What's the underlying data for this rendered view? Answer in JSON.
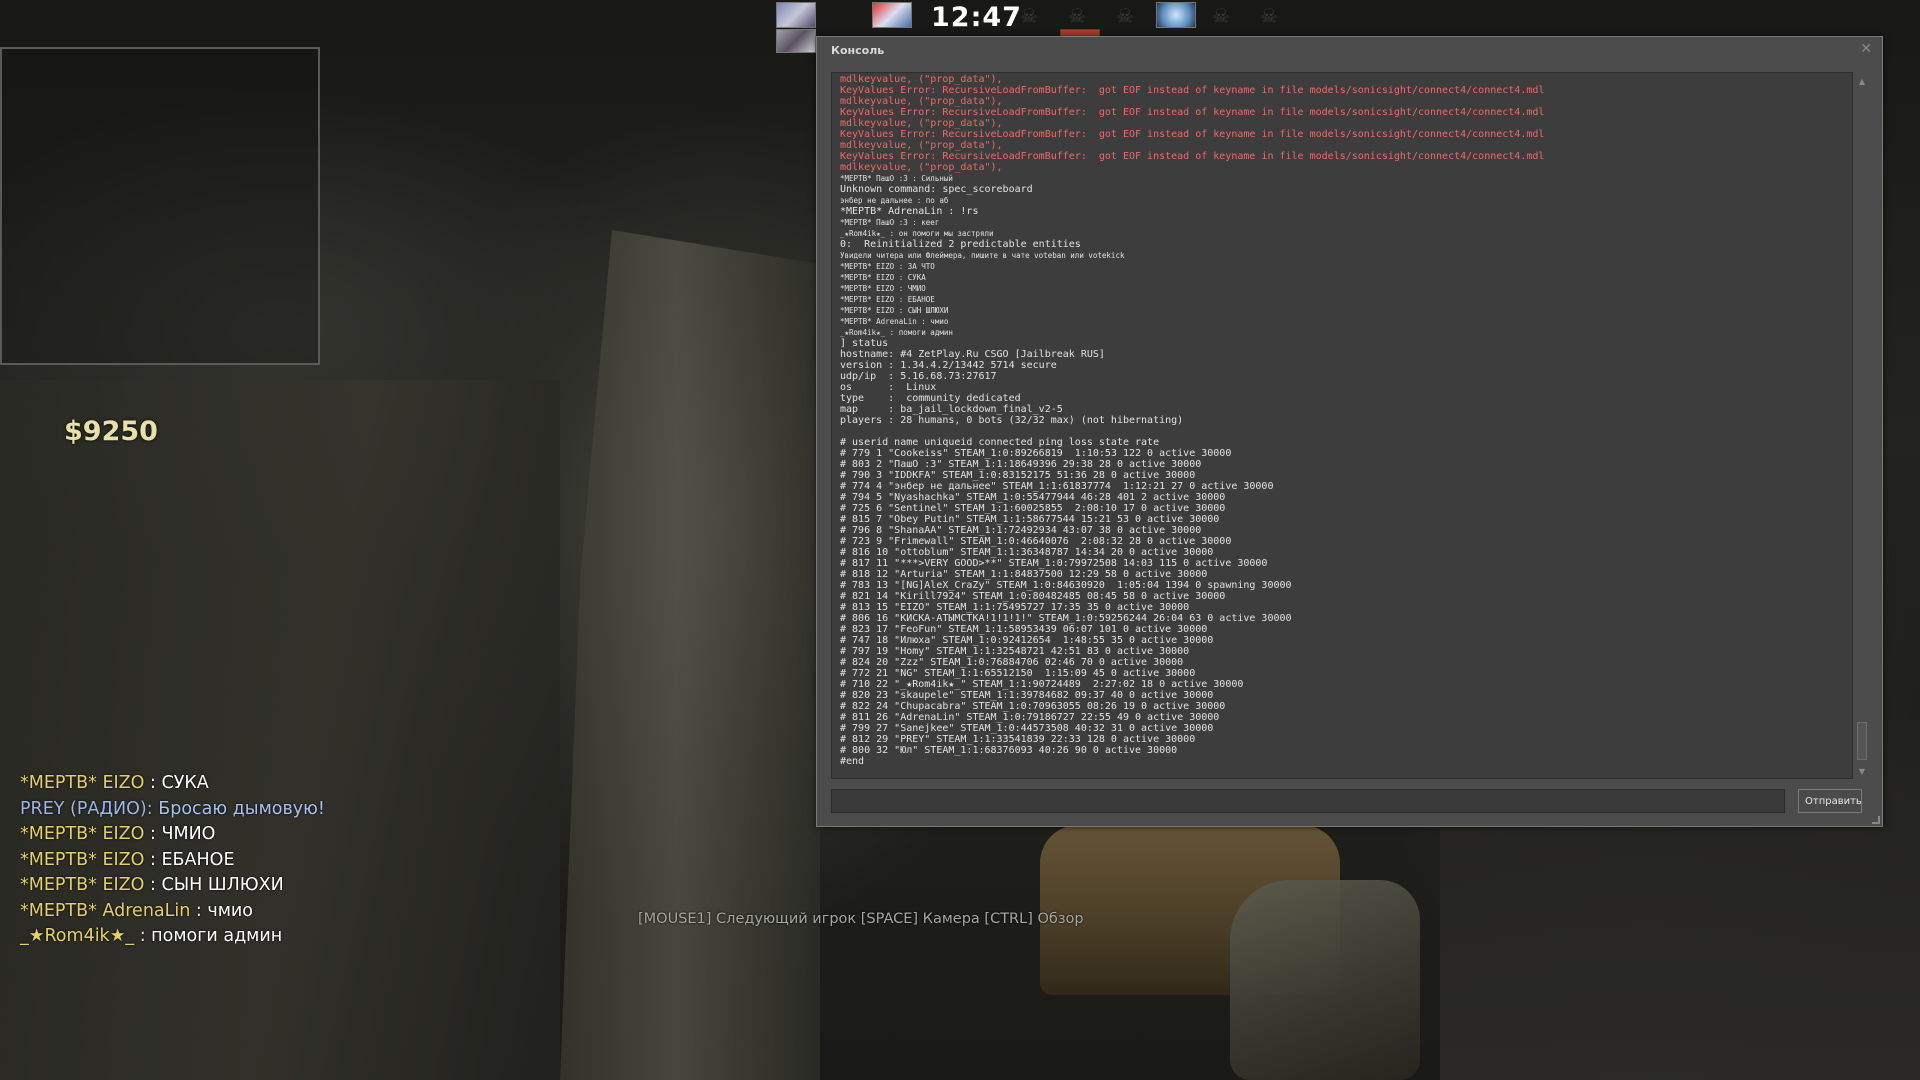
{
  "hud": {
    "clock": "12:47",
    "money": "$9250",
    "spectator_hint": "[MOUSE1] Следующий игрок [SPACE] Камера [CTRL] Обзор"
  },
  "chat": [
    {
      "prefix": "*МЕРТВ* EIZO",
      "sep": " : ",
      "text": "СУКА",
      "style": "dead"
    },
    {
      "prefix": "PREY (РАДИО): ",
      "sep": "",
      "text": "Бросаю дымовую!",
      "style": "radio"
    },
    {
      "prefix": "*МЕРТВ* EIZO",
      "sep": " : ",
      "text": "ЧМИО",
      "style": "dead"
    },
    {
      "prefix": "*МЕРТВ* EIZO",
      "sep": " : ",
      "text": "ЕБАНОЕ",
      "style": "dead"
    },
    {
      "prefix": "*МЕРТВ* EIZO",
      "sep": " : ",
      "text": "СЫН ШЛЮХИ",
      "style": "dead"
    },
    {
      "prefix": "*МЕРТВ* AdrenaLin",
      "sep": " : ",
      "text": "чмио",
      "style": "dead"
    },
    {
      "prefix": "_★Rom4ik★_",
      "sep": " : ",
      "text": "помоги админ",
      "style": "dead"
    }
  ],
  "console": {
    "title": "Консоль",
    "send_label": "Отправить",
    "input_value": "",
    "colors": {
      "error": "#f06868",
      "normal": "#e2e2e2"
    },
    "lines": [
      {
        "t": "mdlkeyvalue, (\"prop_data\"),",
        "c": "err"
      },
      {
        "t": "KeyValues Error: RecursiveLoadFromBuffer:  got EOF instead of keyname in file models/sonicsight/connect4/connect4.mdl",
        "c": "err"
      },
      {
        "t": "mdlkeyvalue, (\"prop_data\"),",
        "c": "err"
      },
      {
        "t": "KeyValues Error: RecursiveLoadFromBuffer:  got EOF instead of keyname in file models/sonicsight/connect4/connect4.mdl",
        "c": "err"
      },
      {
        "t": "mdlkeyvalue, (\"prop_data\"),",
        "c": "err"
      },
      {
        "t": "KeyValues Error: RecursiveLoadFromBuffer:  got EOF instead of keyname in file models/sonicsight/connect4/connect4.mdl",
        "c": "err"
      },
      {
        "t": "mdlkeyvalue, (\"prop_data\"),",
        "c": "err"
      },
      {
        "t": "KeyValues Error: RecursiveLoadFromBuffer:  got EOF instead of keyname in file models/sonicsight/connect4/connect4.mdl",
        "c": "err"
      },
      {
        "t": "mdlkeyvalue, (\"prop_data\"),",
        "c": "err"
      },
      {
        "t": "*МЕРТВ* ПашО :3 : Сильный",
        "c": "small"
      },
      {
        "t": "Unknown command: spec_scoreboard",
        "c": ""
      },
      {
        "t": "энбер не дальнее : по аб",
        "c": "small"
      },
      {
        "t": "*МЕРТВ* AdrenaLin : !rs",
        "c": ""
      },
      {
        "t": "*МЕРТВ* ПашО :3 : кеег",
        "c": "small"
      },
      {
        "t": "_★Rom4ik★_ : он помоги мы застряли",
        "c": "small"
      },
      {
        "t": "0:  Reinitialized 2 predictable entities",
        "c": ""
      },
      {
        "t": "Увидели читера или Флеймера, пишите в чате voteban или votekick",
        "c": "small"
      },
      {
        "t": "*МЕРТВ* EIZO : ЗА ЧТО",
        "c": "small"
      },
      {
        "t": "*МЕРТВ* EIZO : СУКА",
        "c": "small"
      },
      {
        "t": "*МЕРТВ* EIZO : ЧМИО",
        "c": "small"
      },
      {
        "t": "*МЕРТВ* EIZO : ЕБАНОЕ",
        "c": "small"
      },
      {
        "t": "*МЕРТВ* EIZO : СЫН ШЛЮХИ",
        "c": "small"
      },
      {
        "t": "*МЕРТВ* AdrenaLin : чмио",
        "c": "small"
      },
      {
        "t": "_★Rom4ik★_ : помоги админ",
        "c": "small"
      },
      {
        "t": "] status",
        "c": ""
      },
      {
        "t": "hostname: #4 ZetPlay.Ru CSGO [Jailbreak RUS]",
        "c": ""
      },
      {
        "t": "version : 1.34.4.2/13442 5714 secure",
        "c": ""
      },
      {
        "t": "udp/ip  : 5.16.68.73:27617",
        "c": ""
      },
      {
        "t": "os      :  Linux",
        "c": ""
      },
      {
        "t": "type    :  community dedicated",
        "c": ""
      },
      {
        "t": "map     : ba_jail_lockdown_final_v2-5",
        "c": ""
      },
      {
        "t": "players : 28 humans, 0 bots (32/32 max) (not hibernating)",
        "c": ""
      },
      {
        "t": "",
        "c": ""
      },
      {
        "t": "# userid name uniqueid connected ping loss state rate",
        "c": ""
      },
      {
        "t": "# 779 1 \"Cookeiss\" STEAM_1:0:89266819  1:10:53 122 0 active 30000",
        "c": ""
      },
      {
        "t": "# 803 2 \"ПашО :3\" STEAM_1:1:18649396 29:38 28 0 active 30000",
        "c": ""
      },
      {
        "t": "# 790 3 \"IDDKFA\" STEAM_1:0:83152175 51:36 28 0 active 30000",
        "c": ""
      },
      {
        "t": "# 774 4 \"энбер не дальнее\" STEAM_1:1:61837774  1:12:21 27 0 active 30000",
        "c": ""
      },
      {
        "t": "# 794 5 \"Nyashachka\" STEAM_1:0:55477944 46:28 401 2 active 30000",
        "c": ""
      },
      {
        "t": "# 725 6 \"Sentinel\" STEAM_1:1:60025855  2:08:10 17 0 active 30000",
        "c": ""
      },
      {
        "t": "# 815 7 \"Obey Putin\" STEAM_1:1:58677544 15:21 53 0 active 30000",
        "c": ""
      },
      {
        "t": "# 796 8 \"ShanaAA\" STEAM_1:1:72492934 43:07 38 0 active 30000",
        "c": ""
      },
      {
        "t": "# 723 9 \"Frimewall\" STEAM_1:0:46640076  2:08:32 28 0 active 30000",
        "c": ""
      },
      {
        "t": "# 816 10 \"ottoblum\" STEAM_1:1:36348787 14:34 20 0 active 30000",
        "c": ""
      },
      {
        "t": "# 817 11 \"***>VERY GOOD>**\" STEAM_1:0:79972508 14:03 115 0 active 30000",
        "c": ""
      },
      {
        "t": "# 818 12 \"Arturia\" STEAM_1:1:84837500 12:29 58 0 active 30000",
        "c": ""
      },
      {
        "t": "# 783 13 \"[NG]AleX_CraZy\" STEAM_1:0:84630920  1:05:04 1394 0 spawning 30000",
        "c": ""
      },
      {
        "t": "# 821 14 \"Kirill7924\" STEAM_1:0:80482485 08:45 58 0 active 30000",
        "c": ""
      },
      {
        "t": "# 813 15 \"EIZO\" STEAM_1:1:75495727 17:35 35 0 active 30000",
        "c": ""
      },
      {
        "t": "# 806 16 \"КИСКА-АТЫМСТКА!1!1!1!\" STEAM_1:0:59256244 26:04 63 0 active 30000",
        "c": ""
      },
      {
        "t": "# 823 17 \"FeoFun\" STEAM_1:1:58953439 06:07 101 0 active 30000",
        "c": ""
      },
      {
        "t": "# 747 18 \"Илюха\" STEAM_1:0:92412654  1:48:55 35 0 active 30000",
        "c": ""
      },
      {
        "t": "# 797 19 \"Homy\" STEAM_1:1:32548721 42:51 83 0 active 30000",
        "c": ""
      },
      {
        "t": "# 824 20 \"Zzz\" STEAM_1:0:76884706 02:46 70 0 active 30000",
        "c": ""
      },
      {
        "t": "# 772 21 \"NG\" STEAM_1:1:65512150  1:15:09 45 0 active 30000",
        "c": ""
      },
      {
        "t": "# 710 22 \"_★Rom4ik★_\" STEAM_1:1:90724489  2:27:02 18 0 active 30000",
        "c": ""
      },
      {
        "t": "# 820 23 \"skaupele\" STEAM_1:1:39784682 09:37 40 0 active 30000",
        "c": ""
      },
      {
        "t": "# 822 24 \"Chupacabra\" STEAM_1:0:70963055 08:26 19 0 active 30000",
        "c": ""
      },
      {
        "t": "# 811 26 \"AdrenaLin\" STEAM_1:0:79186727 22:55 49 0 active 30000",
        "c": ""
      },
      {
        "t": "# 799 27 \"Sanejkee\" STEAM_1:0:44573508 40:32 31 0 active 30000",
        "c": ""
      },
      {
        "t": "# 812 29 \"PREY\" STEAM_1:1:33541839 22:33 128 0 active 30000",
        "c": ""
      },
      {
        "t": "# 800 32 \"Юл\" STEAM_1:1:68376093 40:26 90 0 active 30000",
        "c": ""
      },
      {
        "t": "#end",
        "c": ""
      }
    ]
  },
  "icons": {
    "close": "close-icon",
    "skull": "skull-icon",
    "scroll_up": "scroll-up-icon",
    "scroll_down": "scroll-down-icon"
  }
}
